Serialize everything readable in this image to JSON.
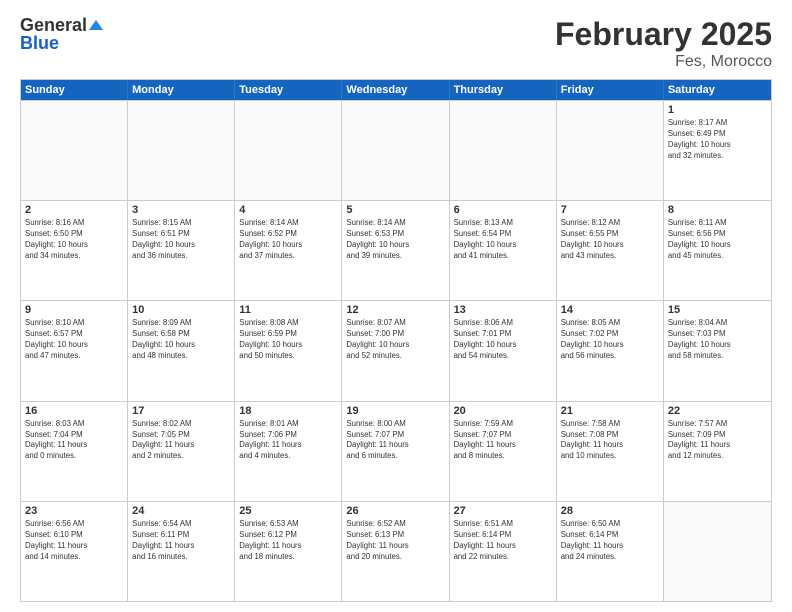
{
  "logo": {
    "general": "General",
    "blue": "Blue"
  },
  "title": "February 2025",
  "location": "Fes, Morocco",
  "header_days": [
    "Sunday",
    "Monday",
    "Tuesday",
    "Wednesday",
    "Thursday",
    "Friday",
    "Saturday"
  ],
  "weeks": [
    [
      {
        "day": "",
        "info": ""
      },
      {
        "day": "",
        "info": ""
      },
      {
        "day": "",
        "info": ""
      },
      {
        "day": "",
        "info": ""
      },
      {
        "day": "",
        "info": ""
      },
      {
        "day": "",
        "info": ""
      },
      {
        "day": "1",
        "info": "Sunrise: 8:17 AM\nSunset: 6:49 PM\nDaylight: 10 hours\nand 32 minutes."
      }
    ],
    [
      {
        "day": "2",
        "info": "Sunrise: 8:16 AM\nSunset: 6:50 PM\nDaylight: 10 hours\nand 34 minutes."
      },
      {
        "day": "3",
        "info": "Sunrise: 8:15 AM\nSunset: 6:51 PM\nDaylight: 10 hours\nand 36 minutes."
      },
      {
        "day": "4",
        "info": "Sunrise: 8:14 AM\nSunset: 6:52 PM\nDaylight: 10 hours\nand 37 minutes."
      },
      {
        "day": "5",
        "info": "Sunrise: 8:14 AM\nSunset: 6:53 PM\nDaylight: 10 hours\nand 39 minutes."
      },
      {
        "day": "6",
        "info": "Sunrise: 8:13 AM\nSunset: 6:54 PM\nDaylight: 10 hours\nand 41 minutes."
      },
      {
        "day": "7",
        "info": "Sunrise: 8:12 AM\nSunset: 6:55 PM\nDaylight: 10 hours\nand 43 minutes."
      },
      {
        "day": "8",
        "info": "Sunrise: 8:11 AM\nSunset: 6:56 PM\nDaylight: 10 hours\nand 45 minutes."
      }
    ],
    [
      {
        "day": "9",
        "info": "Sunrise: 8:10 AM\nSunset: 6:57 PM\nDaylight: 10 hours\nand 47 minutes."
      },
      {
        "day": "10",
        "info": "Sunrise: 8:09 AM\nSunset: 6:58 PM\nDaylight: 10 hours\nand 48 minutes."
      },
      {
        "day": "11",
        "info": "Sunrise: 8:08 AM\nSunset: 6:59 PM\nDaylight: 10 hours\nand 50 minutes."
      },
      {
        "day": "12",
        "info": "Sunrise: 8:07 AM\nSunset: 7:00 PM\nDaylight: 10 hours\nand 52 minutes."
      },
      {
        "day": "13",
        "info": "Sunrise: 8:06 AM\nSunset: 7:01 PM\nDaylight: 10 hours\nand 54 minutes."
      },
      {
        "day": "14",
        "info": "Sunrise: 8:05 AM\nSunset: 7:02 PM\nDaylight: 10 hours\nand 56 minutes."
      },
      {
        "day": "15",
        "info": "Sunrise: 8:04 AM\nSunset: 7:03 PM\nDaylight: 10 hours\nand 58 minutes."
      }
    ],
    [
      {
        "day": "16",
        "info": "Sunrise: 8:03 AM\nSunset: 7:04 PM\nDaylight: 11 hours\nand 0 minutes."
      },
      {
        "day": "17",
        "info": "Sunrise: 8:02 AM\nSunset: 7:05 PM\nDaylight: 11 hours\nand 2 minutes."
      },
      {
        "day": "18",
        "info": "Sunrise: 8:01 AM\nSunset: 7:06 PM\nDaylight: 11 hours\nand 4 minutes."
      },
      {
        "day": "19",
        "info": "Sunrise: 8:00 AM\nSunset: 7:07 PM\nDaylight: 11 hours\nand 6 minutes."
      },
      {
        "day": "20",
        "info": "Sunrise: 7:59 AM\nSunset: 7:07 PM\nDaylight: 11 hours\nand 8 minutes."
      },
      {
        "day": "21",
        "info": "Sunrise: 7:58 AM\nSunset: 7:08 PM\nDaylight: 11 hours\nand 10 minutes."
      },
      {
        "day": "22",
        "info": "Sunrise: 7:57 AM\nSunset: 7:09 PM\nDaylight: 11 hours\nand 12 minutes."
      }
    ],
    [
      {
        "day": "23",
        "info": "Sunrise: 6:56 AM\nSunset: 6:10 PM\nDaylight: 11 hours\nand 14 minutes."
      },
      {
        "day": "24",
        "info": "Sunrise: 6:54 AM\nSunset: 6:11 PM\nDaylight: 11 hours\nand 16 minutes."
      },
      {
        "day": "25",
        "info": "Sunrise: 6:53 AM\nSunset: 6:12 PM\nDaylight: 11 hours\nand 18 minutes."
      },
      {
        "day": "26",
        "info": "Sunrise: 6:52 AM\nSunset: 6:13 PM\nDaylight: 11 hours\nand 20 minutes."
      },
      {
        "day": "27",
        "info": "Sunrise: 6:51 AM\nSunset: 6:14 PM\nDaylight: 11 hours\nand 22 minutes."
      },
      {
        "day": "28",
        "info": "Sunrise: 6:50 AM\nSunset: 6:14 PM\nDaylight: 11 hours\nand 24 minutes."
      },
      {
        "day": "",
        "info": ""
      }
    ]
  ]
}
